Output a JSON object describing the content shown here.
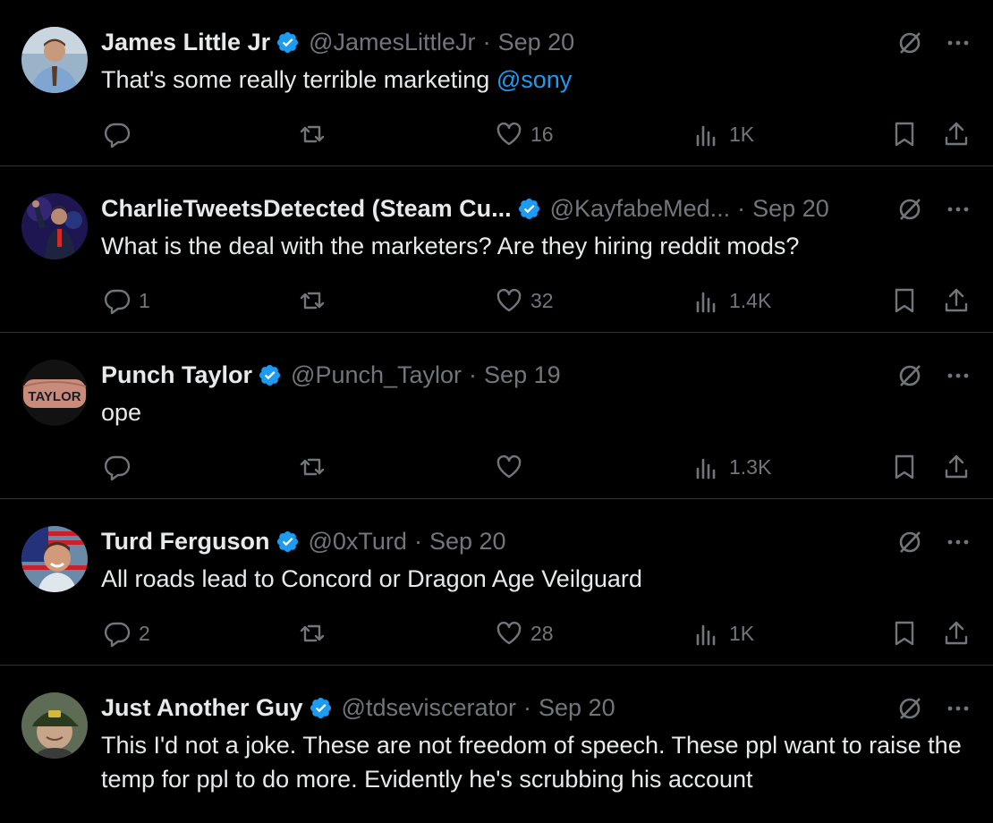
{
  "tweets": [
    {
      "name": "James Little Jr",
      "handle": "@JamesLittleJr",
      "date": "Sep 20",
      "text": "That's some really terrible marketing ",
      "mention": "@sony",
      "reply_count": "",
      "like_count": "16",
      "view_count": "1K",
      "avatar_icon": "avatar-man-in-suit"
    },
    {
      "name": "CharlieTweetsDetected (Steam Cu...",
      "handle": "@KayfabeMed...",
      "date": "Sep 20",
      "text": "What is the deal with the marketers? Are they hiring reddit mods?",
      "mention": "",
      "reply_count": "1",
      "like_count": "32",
      "view_count": "1.4K",
      "avatar_icon": "avatar-man-on-stage"
    },
    {
      "name": "Punch Taylor",
      "handle": "@Punch_Taylor",
      "date": "Sep 19",
      "text": "ope",
      "mention": "",
      "reply_count": "",
      "like_count": "",
      "view_count": "1.3K",
      "avatar_icon": "avatar-tattooed-knuckles",
      "avatar_text": "TAYLOR"
    },
    {
      "name": "Turd Ferguson",
      "handle": "@0xTurd",
      "date": "Sep 20",
      "text": "All roads lead to Concord or Dragon Age Veilguard",
      "mention": "",
      "reply_count": "2",
      "like_count": "28",
      "view_count": "1K",
      "avatar_icon": "avatar-man-with-flag"
    },
    {
      "name": "Just Another Guy",
      "handle": "@tdseviscerator",
      "date": "Sep 20",
      "text": "This I'd not a joke. These are not freedom of speech. These ppl want to raise the temp for ppl to do more. Evidently he's scrubbing his account",
      "mention": "",
      "reply_count": "",
      "like_count": "",
      "view_count": "",
      "avatar_icon": "avatar-man-in-cap"
    }
  ],
  "colors": {
    "background": "#000000",
    "text_primary": "#e7e9ea",
    "text_secondary": "#71767b",
    "accent": "#1d9bf0",
    "divider": "#2f3336"
  },
  "icons": {
    "verified": "verified-badge-icon",
    "grok": "grok-icon",
    "more": "more-options-icon",
    "reply": "reply-icon",
    "retweet": "retweet-icon",
    "like": "like-icon",
    "views": "views-icon",
    "bookmark": "bookmark-icon",
    "share": "share-icon"
  }
}
